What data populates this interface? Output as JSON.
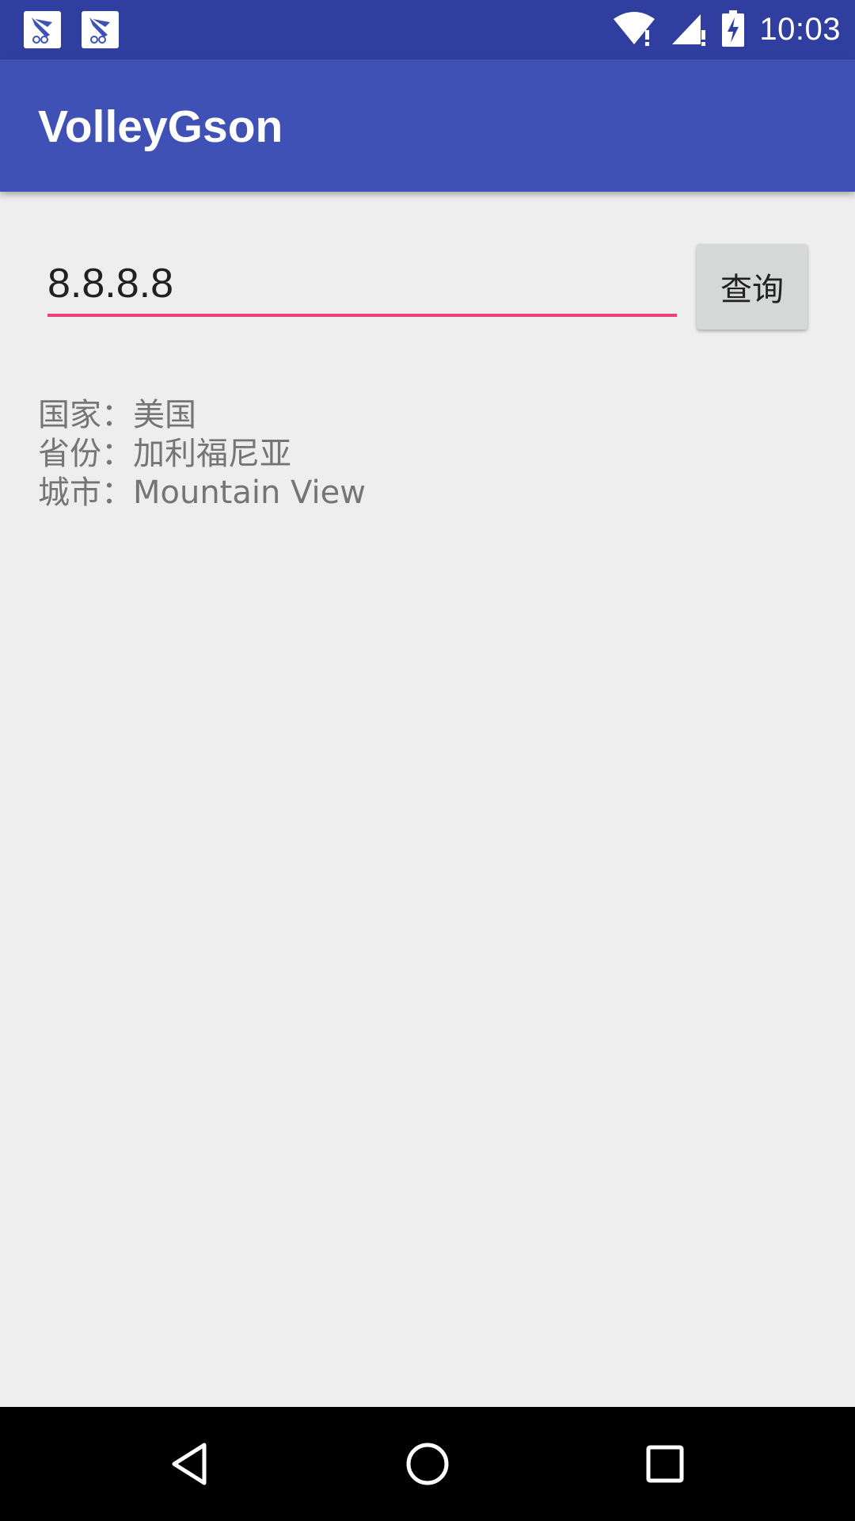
{
  "status_bar": {
    "time": "10:03",
    "notification_icons": [
      "app-notification-icon",
      "app-notification-icon"
    ],
    "system_icons": [
      "wifi-icon",
      "signal-icon",
      "battery-charging-icon"
    ]
  },
  "app_bar": {
    "title": "VolleyGson"
  },
  "search": {
    "value": "8.8.8.8",
    "button_label": "查询"
  },
  "result": {
    "country": "国家：美国",
    "province": "省份：加利福尼亚",
    "city": "城市：Mountain View"
  },
  "nav_bar": {
    "icons": [
      "back-icon",
      "home-icon",
      "recents-icon"
    ]
  },
  "colors": {
    "status_bar": "#303f9f",
    "app_bar": "#3f51b5",
    "accent": "#ec407a",
    "background": "#eeeeee"
  }
}
